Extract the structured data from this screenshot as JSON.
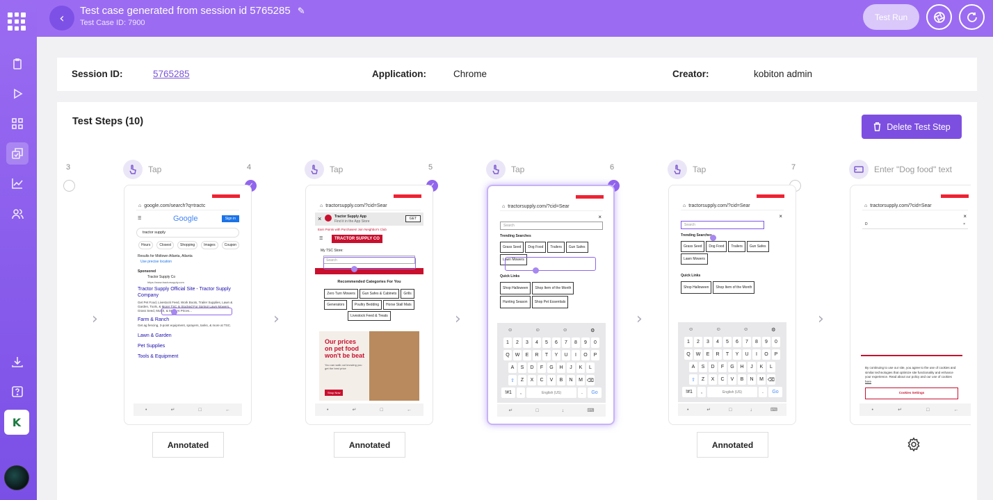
{
  "header": {
    "title": "Test case generated from session id 5765285",
    "subtitle": "Test Case ID: 7900",
    "test_run_label": "Test Run"
  },
  "sidebar": {
    "avatar_letter": "K",
    "items": [
      "clipboard-icon",
      "play-icon",
      "grid-icon",
      "test-cases-icon",
      "chart-icon",
      "users-icon",
      "download-icon",
      "help-icon"
    ]
  },
  "info": {
    "session_label": "Session ID:",
    "session_value": "5765285",
    "application_label": "Application:",
    "application_value": "Chrome",
    "creator_label": "Creator:",
    "creator_value": "kobiton admin"
  },
  "steps_panel": {
    "title": "Test Steps (10)",
    "delete_label": "Delete Test Step",
    "steps": [
      {
        "left_num": "3",
        "right_num": "4",
        "action": "Tap",
        "checked": false,
        "annotation": "Annotated"
      },
      {
        "left_num": "",
        "right_num": "5",
        "action": "Tap",
        "checked": true,
        "annotation": "Annotated"
      },
      {
        "left_num": "",
        "right_num": "6",
        "action": "Tap",
        "checked": true,
        "annotation": ""
      },
      {
        "left_num": "",
        "right_num": "7",
        "action": "Tap",
        "checked": true,
        "annotation": "Annotated"
      },
      {
        "left_num": "",
        "right_num": "",
        "action": "Tap",
        "checked": false,
        "annotation": ""
      },
      {
        "left_num": "",
        "right_num": "",
        "action": "Enter \"Dog food\" text",
        "checked": false,
        "annotation": ""
      }
    ]
  },
  "screens": {
    "google": {
      "url": "google.com/search?q=tractc",
      "logo": "Google",
      "sign_in": "Sign in",
      "query": "tractor supply",
      "chips": [
        "Hours",
        "Closest",
        "Shopping",
        "Images",
        "Coupon"
      ],
      "results_for": "Results for Midtown Atlanta, Atlanta",
      "precise": "Use precise location",
      "sponsored": "Sponsored",
      "site": "Tractor Supply Co",
      "site_url": "https://www.tractorsupply.com",
      "result_title": "Tractor Supply Official Site - Tractor Supply Company",
      "result_desc": "Get Pet Food, Livestock Feed, Work Boots, Trailer Supplies, Lawn & Garden, Tools, & More! TSC Is Stocked For Spring! Lawn Mowers, Grass Seed, Mulch, & More At Prices...",
      "link1": "Farm & Ranch",
      "link1_desc": "Get ag fencing, 3-point equipment, sprayers, tanks, & more at TSC.",
      "link2": "Lawn & Garden",
      "link3": "Pet Supplies",
      "link4": "Tools & Equipment"
    },
    "tsc": {
      "url": "tractorsupply.com/?cid=Sear",
      "app_banner": "Tractor Supply App",
      "app_sub": "Find it in the App Store",
      "get": "GET",
      "earn": "Earn Points with Purchases! Join Neighbor's Club",
      "more": "More",
      "logo": "TRACTOR SUPPLY CO",
      "my_store": "My TSC Store:",
      "search": "Search",
      "recommended": "Recommended Categories For You",
      "cats": [
        "Zero Turn Mowers",
        "Gun Safes & Cabinets",
        "Grills",
        "Generators",
        "Poultry Bedding",
        "Horse Stall Mats",
        "Livestock Feed & Treats"
      ],
      "promo1": "Our prices",
      "promo2": "on pet food",
      "promo3": "won't be beat",
      "promo_small": "You can walk out knowing you get the best price",
      "shop_now": "Shop Now"
    },
    "search": {
      "url": "tractorsupply.com/?cid=Sear",
      "placeholder": "Search",
      "trending": "Trending Searches",
      "trending_tags": [
        "Grass Seed",
        "Dog Food",
        "Trailers",
        "Gun Safes",
        "Lawn Mowers"
      ],
      "quick": "Quick Links",
      "quick_tags": [
        "Shop Halloween",
        "Shop Item of the Month",
        "Hunting Season",
        "Shop Pet Essentials"
      ],
      "kb_num": [
        "1",
        "2",
        "3",
        "4",
        "5",
        "6",
        "7",
        "8",
        "9",
        "0"
      ],
      "kb_r1": [
        "Q",
        "W",
        "E",
        "R",
        "T",
        "Y",
        "U",
        "I",
        "O",
        "P"
      ],
      "kb_r2": [
        "A",
        "S",
        "D",
        "F",
        "G",
        "H",
        "J",
        "K",
        "L"
      ],
      "kb_r3": [
        "Z",
        "X",
        "C",
        "V",
        "B",
        "N",
        "M"
      ],
      "kb_sym": "!#1",
      "kb_space": "English (US)",
      "kb_go": "Go"
    },
    "last": {
      "url": "tractorsupply.com/?cid=Sear",
      "typed": "D",
      "cookie_text": "By continuing to use our site, you agree to the use of cookies and similar technologies that optimize site functionality and enhance your experience. Read about our policy and our use of cookies",
      "here": "here",
      "cookie_btn": "Cookies Settings"
    }
  }
}
